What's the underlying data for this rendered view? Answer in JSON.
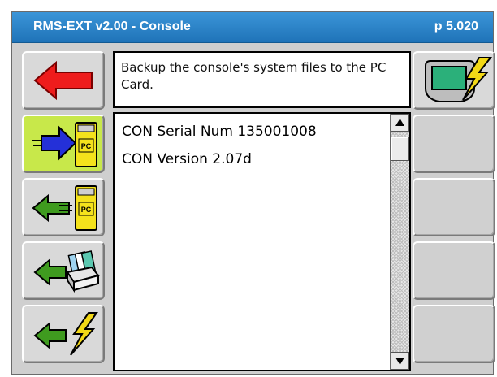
{
  "titlebar": {
    "title": "RMS-EXT v2.00 - Console",
    "page_number": "p 5.020"
  },
  "message": "Backup the console's system files to the PC Card.",
  "list": {
    "lines": [
      "CON Serial Num 135001008",
      "CON Version 2.07d"
    ]
  },
  "card_label": "PC",
  "colors": {
    "title_bar": "#2a84c8",
    "active_button": "#c8e84a",
    "back_arrow": "#ee1c1c",
    "green_arrow": "#3f9b1f",
    "blue_arrow": "#2430d8",
    "pc_card": "#f4e21c",
    "console_screen": "#2bb07a",
    "lightning": "#f2d816"
  }
}
